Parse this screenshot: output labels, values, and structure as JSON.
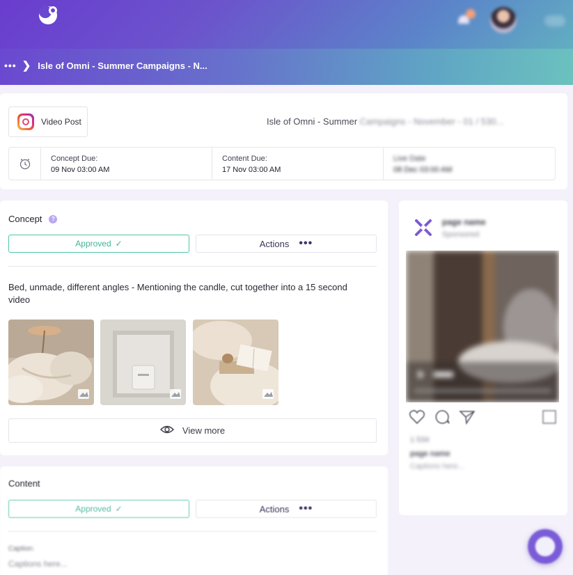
{
  "header": {
    "breadcrumb_dots": "•••",
    "breadcrumb_separator": "❯",
    "breadcrumb_title": "Isle of Omni - Summer Campaigns - N..."
  },
  "post": {
    "platform_label": "Video Post",
    "campaign_title_visible": "Isle of Omni - Summer",
    "campaign_title_blurred": "Campaigns - November - 01 / 530...",
    "dates": [
      {
        "label": "Concept Due:",
        "value": "09 Nov 03:00 AM"
      },
      {
        "label": "Content Due:",
        "value": "17 Nov 03:00 AM"
      },
      {
        "label": "Live Date",
        "value": "08 Dec 03:00 AM"
      }
    ]
  },
  "concept": {
    "title": "Concept",
    "help_glyph": "?",
    "approved_label": "Approved",
    "approved_check": "✓",
    "actions_label": "Actions",
    "actions_more": "•••",
    "description": "Bed, unmade, different angles - Mentioning the candle, cut together into a 15 second video",
    "view_more_label": "View more"
  },
  "content": {
    "title": "Content",
    "approved_label": "Approved",
    "approved_check": "✓",
    "actions_label": "Actions",
    "actions_more": "•••",
    "caption_label": "Caption:",
    "caption_value": "Captions here..."
  },
  "preview": {
    "page_name": "page name",
    "sponsored": "Sponsored",
    "video_time": "0:00",
    "likes": "1 534",
    "username": "page name",
    "caption": "Captions here..."
  },
  "colors": {
    "accent_green": "#3fb597",
    "brand_purple": "#6a3ccf",
    "teal": "#63b7bf"
  }
}
